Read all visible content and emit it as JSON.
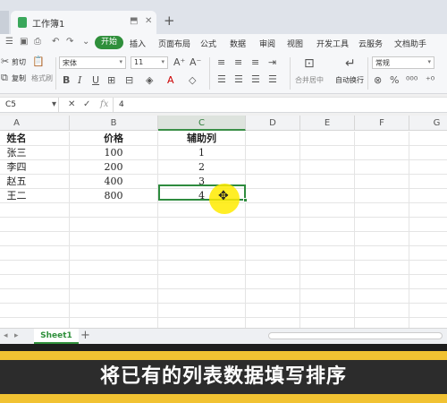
{
  "tabs": {
    "document_title": "工作簿1",
    "add_tab": "+"
  },
  "menu": {
    "start": "开始",
    "items": [
      "插入",
      "页面布局",
      "公式",
      "数据",
      "审阅",
      "视图",
      "开发工具",
      "云服务",
      "文档助手"
    ]
  },
  "ribbon": {
    "cut": "剪切",
    "copy": "复制",
    "format_painter": "格式刷",
    "font_name": "宋体",
    "font_size": "11",
    "merge_center": "合并居中",
    "wrap_text": "自动换行",
    "number_format": "常规"
  },
  "formula_bar": {
    "name_box": "C5",
    "fx": "fx",
    "value": "4"
  },
  "columns": [
    "A",
    "B",
    "C",
    "D",
    "E",
    "F",
    "G"
  ],
  "selected_column": "C",
  "rows": [
    [
      "姓名",
      "价格",
      "辅助列"
    ],
    [
      "张三",
      "100",
      "1"
    ],
    [
      "李四",
      "200",
      "2"
    ],
    [
      "赵五",
      "400",
      "3"
    ],
    [
      "王二",
      "800",
      "4"
    ]
  ],
  "sheet_tabs": {
    "active": "Sheet1",
    "add": "+"
  },
  "caption": "将已有的列表数据填写排序",
  "colors": {
    "accent_green": "#2f8f3b",
    "banner_yellow": "#f1c232",
    "cursor_highlight": "#ffeb00"
  }
}
